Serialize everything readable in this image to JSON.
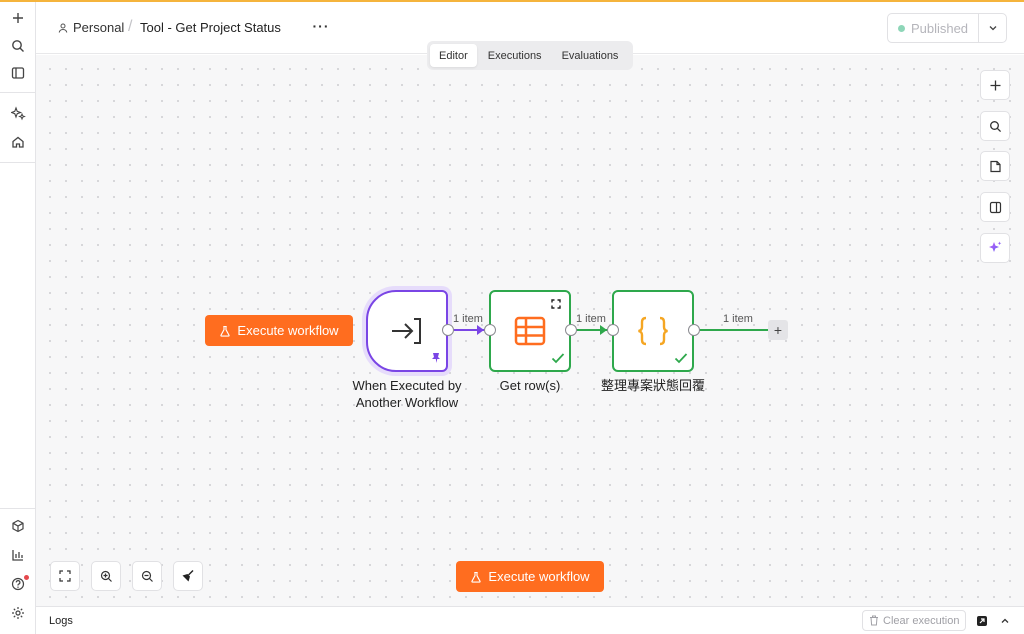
{
  "header": {
    "project": "Personal",
    "workflow_title": "Tool - Get Project Status",
    "more": "···",
    "publish_label": "Published"
  },
  "tabs": [
    {
      "label": "Editor",
      "active": true
    },
    {
      "label": "Executions",
      "active": false
    },
    {
      "label": "Evaluations",
      "active": false
    }
  ],
  "canvas": {
    "execute_label": "Execute workflow",
    "nodes": [
      {
        "label": "When Executed by Another Workflow",
        "type": "trigger",
        "icon": "sign-in-arrow-icon",
        "pinned": true
      },
      {
        "label": "Get row(s)",
        "type": "data-table",
        "icon": "table-icon",
        "status": "success"
      },
      {
        "label": "整理專案狀態回覆",
        "type": "code",
        "icon": "curly-braces-icon",
        "status": "success"
      }
    ],
    "connections": [
      "1 item",
      "1 item",
      "1 item"
    ]
  },
  "logs": {
    "title": "Logs",
    "clear_label": "Clear execution"
  },
  "colors": {
    "accent": "#ff6d1f",
    "trigger": "#7a45e5",
    "success": "#2ea84c",
    "code_icon": "#f5a623",
    "top_line": "#f5b43c"
  }
}
